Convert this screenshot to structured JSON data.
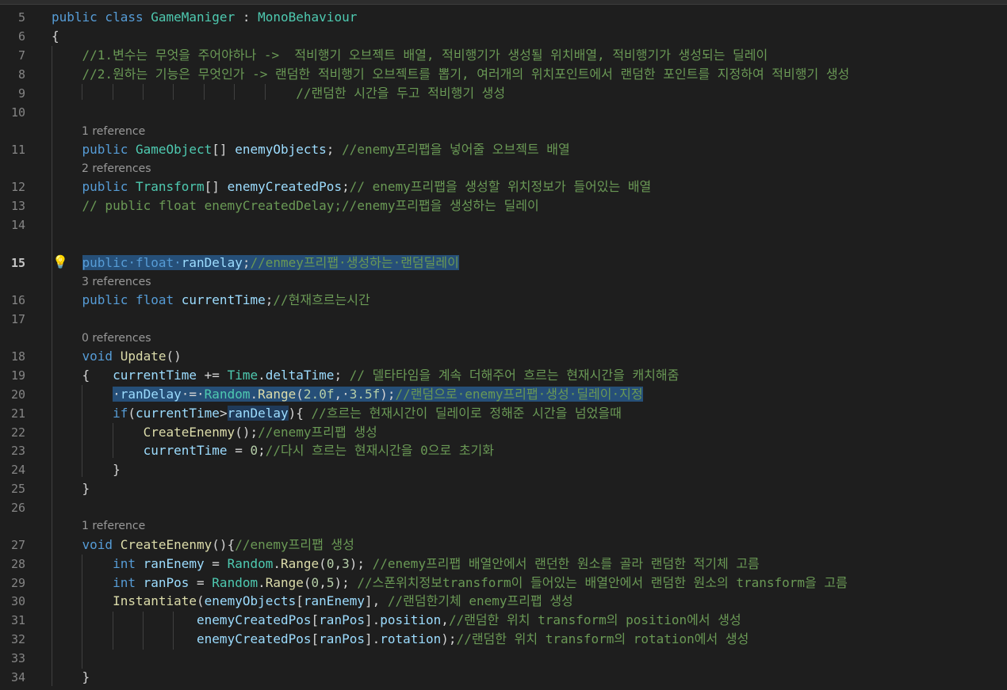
{
  "editor": {
    "active_line": "15",
    "lines": [
      {
        "num": "5",
        "tokens": [
          {
            "t": "public class ",
            "c": "kw"
          },
          {
            "t": "GameManiger",
            "c": "ty"
          },
          {
            "t": " : ",
            "c": "pl"
          },
          {
            "t": "MonoBehaviour",
            "c": "ty"
          }
        ]
      },
      {
        "num": "6",
        "tokens": [
          {
            "t": "{",
            "c": "pl"
          }
        ]
      },
      {
        "num": "7",
        "tokens": [
          {
            "t": "    //1.변수는 무엇을 주어야하나 ->  적비행기 오브젝트 배열, 적비행기가 생성될 위치배열, 적비행기가 생성되는 딜레이",
            "c": "cm"
          }
        ]
      },
      {
        "num": "8",
        "tokens": [
          {
            "t": "    //2.원하는 기능은 무엇인가 -> 랜덤한 적비행기 오브젝트를 뽑기, 여러개의 위치포인트에서 랜덤한 포인트를 지정하여 적비행기 생성",
            "c": "cm"
          }
        ]
      },
      {
        "num": "9",
        "tokens": [
          {
            "t": "                                //랜덤한 시간을 두고 적비행기 생성",
            "c": "cm"
          }
        ]
      },
      {
        "num": "10",
        "tokens": []
      },
      {
        "num": "11",
        "tokens": [
          {
            "t": "    public ",
            "c": "kw"
          },
          {
            "t": "GameObject",
            "c": "ty"
          },
          {
            "t": "[] ",
            "c": "pl"
          },
          {
            "t": "enemyObjects",
            "c": "vr"
          },
          {
            "t": "; ",
            "c": "pl"
          },
          {
            "t": "//enemy프리팹을 넣어줄 오브젝트 배열",
            "c": "cm"
          }
        ]
      },
      {
        "num": "12",
        "tokens": [
          {
            "t": "    public ",
            "c": "kw"
          },
          {
            "t": "Transform",
            "c": "ty"
          },
          {
            "t": "[] ",
            "c": "pl"
          },
          {
            "t": "enemyCreatedPos",
            "c": "vr"
          },
          {
            "t": ";",
            "c": "pl"
          },
          {
            "t": "// enemy프리팹을 생성할 위치정보가 들어있는 배열",
            "c": "cm"
          }
        ]
      },
      {
        "num": "13",
        "tokens": [
          {
            "t": "    // public float enemyCreatedDelay;//enemy프리팹을 생성하는 딜레이",
            "c": "cm"
          }
        ]
      },
      {
        "num": "14",
        "tokens": []
      },
      {
        "num": "15",
        "tokens": [
          {
            "t": "    ",
            "c": "pl"
          },
          {
            "t": "public·float·",
            "c": "kw",
            "s": 1
          },
          {
            "t": "ranDelay",
            "c": "vr",
            "s": 1
          },
          {
            "t": ";",
            "c": "pl",
            "s": 1
          },
          {
            "t": "//enmey프리팹·생성하는·랜덤딜레이",
            "c": "cm",
            "s": 1
          }
        ]
      },
      {
        "num": "16",
        "tokens": [
          {
            "t": "    public float ",
            "c": "kw"
          },
          {
            "t": "currentTime",
            "c": "vr"
          },
          {
            "t": ";",
            "c": "pl"
          },
          {
            "t": "//현재흐르는시간",
            "c": "cm"
          }
        ]
      },
      {
        "num": "17",
        "tokens": []
      },
      {
        "num": "18",
        "tokens": [
          {
            "t": "    void ",
            "c": "kw"
          },
          {
            "t": "Update",
            "c": "fn"
          },
          {
            "t": "()",
            "c": "pl"
          }
        ]
      },
      {
        "num": "19",
        "tokens": [
          {
            "t": "    {   ",
            "c": "pl"
          },
          {
            "t": "currentTime",
            "c": "vr"
          },
          {
            "t": " += ",
            "c": "pl"
          },
          {
            "t": "Time",
            "c": "ty"
          },
          {
            "t": ".",
            "c": "pl"
          },
          {
            "t": "deltaTime",
            "c": "vr"
          },
          {
            "t": "; ",
            "c": "pl"
          },
          {
            "t": "// 델타타임을 계속 더해주어 흐르는 현재시간을 캐치해줌",
            "c": "cm"
          }
        ]
      },
      {
        "num": "20",
        "tokens": [
          {
            "t": "        ",
            "c": "pl"
          },
          {
            "t": "·",
            "c": "pl",
            "s": 1
          },
          {
            "t": "ranDelay",
            "c": "vr",
            "s": 1
          },
          {
            "t": "·=·",
            "c": "pl",
            "s": 1
          },
          {
            "t": "Random",
            "c": "ty",
            "s": 1
          },
          {
            "t": ".",
            "c": "pl",
            "s": 1
          },
          {
            "t": "Range",
            "c": "fn",
            "s": 1
          },
          {
            "t": "(",
            "c": "pl",
            "s": 1
          },
          {
            "t": "2.0f",
            "c": "nm",
            "s": 1
          },
          {
            "t": ",·",
            "c": "pl",
            "s": 1
          },
          {
            "t": "3.5f",
            "c": "nm",
            "s": 1
          },
          {
            "t": ");",
            "c": "pl",
            "s": 1
          },
          {
            "t": "//랜덤으로·enemy프리팹·생성·딜레이·지정",
            "c": "cm",
            "s": 1
          }
        ]
      },
      {
        "num": "21",
        "tokens": [
          {
            "t": "        if",
            "c": "kw"
          },
          {
            "t": "(",
            "c": "pl"
          },
          {
            "t": "currentTime",
            "c": "vr"
          },
          {
            "t": ">",
            "c": "pl"
          },
          {
            "t": "ranDelay",
            "c": "vr",
            "s": 2
          },
          {
            "t": "){ ",
            "c": "pl"
          },
          {
            "t": "//흐르는 현재시간이 딜레이로 정해준 시간을 넘었을때",
            "c": "cm"
          }
        ]
      },
      {
        "num": "22",
        "tokens": [
          {
            "t": "            ",
            "c": "pl"
          },
          {
            "t": "CreateEnenmy",
            "c": "fn"
          },
          {
            "t": "();",
            "c": "pl"
          },
          {
            "t": "//enemy프리팹 생성",
            "c": "cm"
          }
        ]
      },
      {
        "num": "23",
        "tokens": [
          {
            "t": "            ",
            "c": "pl"
          },
          {
            "t": "currentTime",
            "c": "vr"
          },
          {
            "t": " = ",
            "c": "pl"
          },
          {
            "t": "0",
            "c": "nm"
          },
          {
            "t": ";",
            "c": "pl"
          },
          {
            "t": "//다시 흐르는 현재시간을 0으로 초기화",
            "c": "cm"
          }
        ]
      },
      {
        "num": "24",
        "tokens": [
          {
            "t": "        }",
            "c": "pl"
          }
        ]
      },
      {
        "num": "25",
        "tokens": [
          {
            "t": "    }",
            "c": "pl"
          }
        ]
      },
      {
        "num": "26",
        "tokens": []
      },
      {
        "num": "27",
        "tokens": [
          {
            "t": "    void ",
            "c": "kw"
          },
          {
            "t": "CreateEnenmy",
            "c": "fn"
          },
          {
            "t": "(){",
            "c": "pl"
          },
          {
            "t": "//enemy프리팹 생성",
            "c": "cm"
          }
        ]
      },
      {
        "num": "28",
        "tokens": [
          {
            "t": "        int ",
            "c": "kw"
          },
          {
            "t": "ranEnemy",
            "c": "vr"
          },
          {
            "t": " = ",
            "c": "pl"
          },
          {
            "t": "Random",
            "c": "ty"
          },
          {
            "t": ".",
            "c": "pl"
          },
          {
            "t": "Range",
            "c": "fn"
          },
          {
            "t": "(",
            "c": "pl"
          },
          {
            "t": "0",
            "c": "nm"
          },
          {
            "t": ",",
            "c": "pl"
          },
          {
            "t": "3",
            "c": "nm"
          },
          {
            "t": "); ",
            "c": "pl"
          },
          {
            "t": "//enemy프리팹 배열안에서 랜던한 원소를 골라 랜덤한 적기체 고름",
            "c": "cm"
          }
        ]
      },
      {
        "num": "29",
        "tokens": [
          {
            "t": "        int ",
            "c": "kw"
          },
          {
            "t": "ranPos",
            "c": "vr"
          },
          {
            "t": " = ",
            "c": "pl"
          },
          {
            "t": "Random",
            "c": "ty"
          },
          {
            "t": ".",
            "c": "pl"
          },
          {
            "t": "Range",
            "c": "fn"
          },
          {
            "t": "(",
            "c": "pl"
          },
          {
            "t": "0",
            "c": "nm"
          },
          {
            "t": ",",
            "c": "pl"
          },
          {
            "t": "5",
            "c": "nm"
          },
          {
            "t": "); ",
            "c": "pl"
          },
          {
            "t": "//스폰위치정보transform이 들어있는 배열안에서 랜덤한 원소의 transform을 고름",
            "c": "cm"
          }
        ]
      },
      {
        "num": "30",
        "tokens": [
          {
            "t": "        ",
            "c": "pl"
          },
          {
            "t": "Instantiate",
            "c": "fn"
          },
          {
            "t": "(",
            "c": "pl"
          },
          {
            "t": "enemyObjects",
            "c": "vr"
          },
          {
            "t": "[",
            "c": "pl"
          },
          {
            "t": "ranEnemy",
            "c": "vr"
          },
          {
            "t": "], ",
            "c": "pl"
          },
          {
            "t": "//랜덤한기체 enemy프리팹 생성",
            "c": "cm"
          }
        ]
      },
      {
        "num": "31",
        "tokens": [
          {
            "t": "                   ",
            "c": "pl"
          },
          {
            "t": "enemyCreatedPos",
            "c": "vr"
          },
          {
            "t": "[",
            "c": "pl"
          },
          {
            "t": "ranPos",
            "c": "vr"
          },
          {
            "t": "].",
            "c": "pl"
          },
          {
            "t": "position",
            "c": "vr"
          },
          {
            "t": ",",
            "c": "pl"
          },
          {
            "t": "//랜덤한 위치 transform의 position에서 생성",
            "c": "cm"
          }
        ]
      },
      {
        "num": "32",
        "tokens": [
          {
            "t": "                   ",
            "c": "pl"
          },
          {
            "t": "enemyCreatedPos",
            "c": "vr"
          },
          {
            "t": "[",
            "c": "pl"
          },
          {
            "t": "ranPos",
            "c": "vr"
          },
          {
            "t": "].",
            "c": "pl"
          },
          {
            "t": "rotation",
            "c": "vr"
          },
          {
            "t": ");",
            "c": "pl"
          },
          {
            "t": "//랜덤한 위치 transform의 rotation에서 생성",
            "c": "cm"
          }
        ]
      },
      {
        "num": "33",
        "tokens": []
      },
      {
        "num": "34",
        "tokens": [
          {
            "t": "    }",
            "c": "pl"
          }
        ]
      }
    ],
    "codelens": {
      "l11": "1 reference",
      "l12": "2 references",
      "l16": "3 references",
      "l18": "0 references",
      "l27": "1 reference"
    },
    "gutter_icon": "lightbulb-icon"
  },
  "colors": {
    "background": "#1e1e1e",
    "keyword": "#569cd6",
    "type": "#4ec9b0",
    "function": "#dcdcaa",
    "variable": "#9cdcfe",
    "comment": "#6a9955",
    "number": "#b5cea8",
    "selection": "#264f78"
  }
}
